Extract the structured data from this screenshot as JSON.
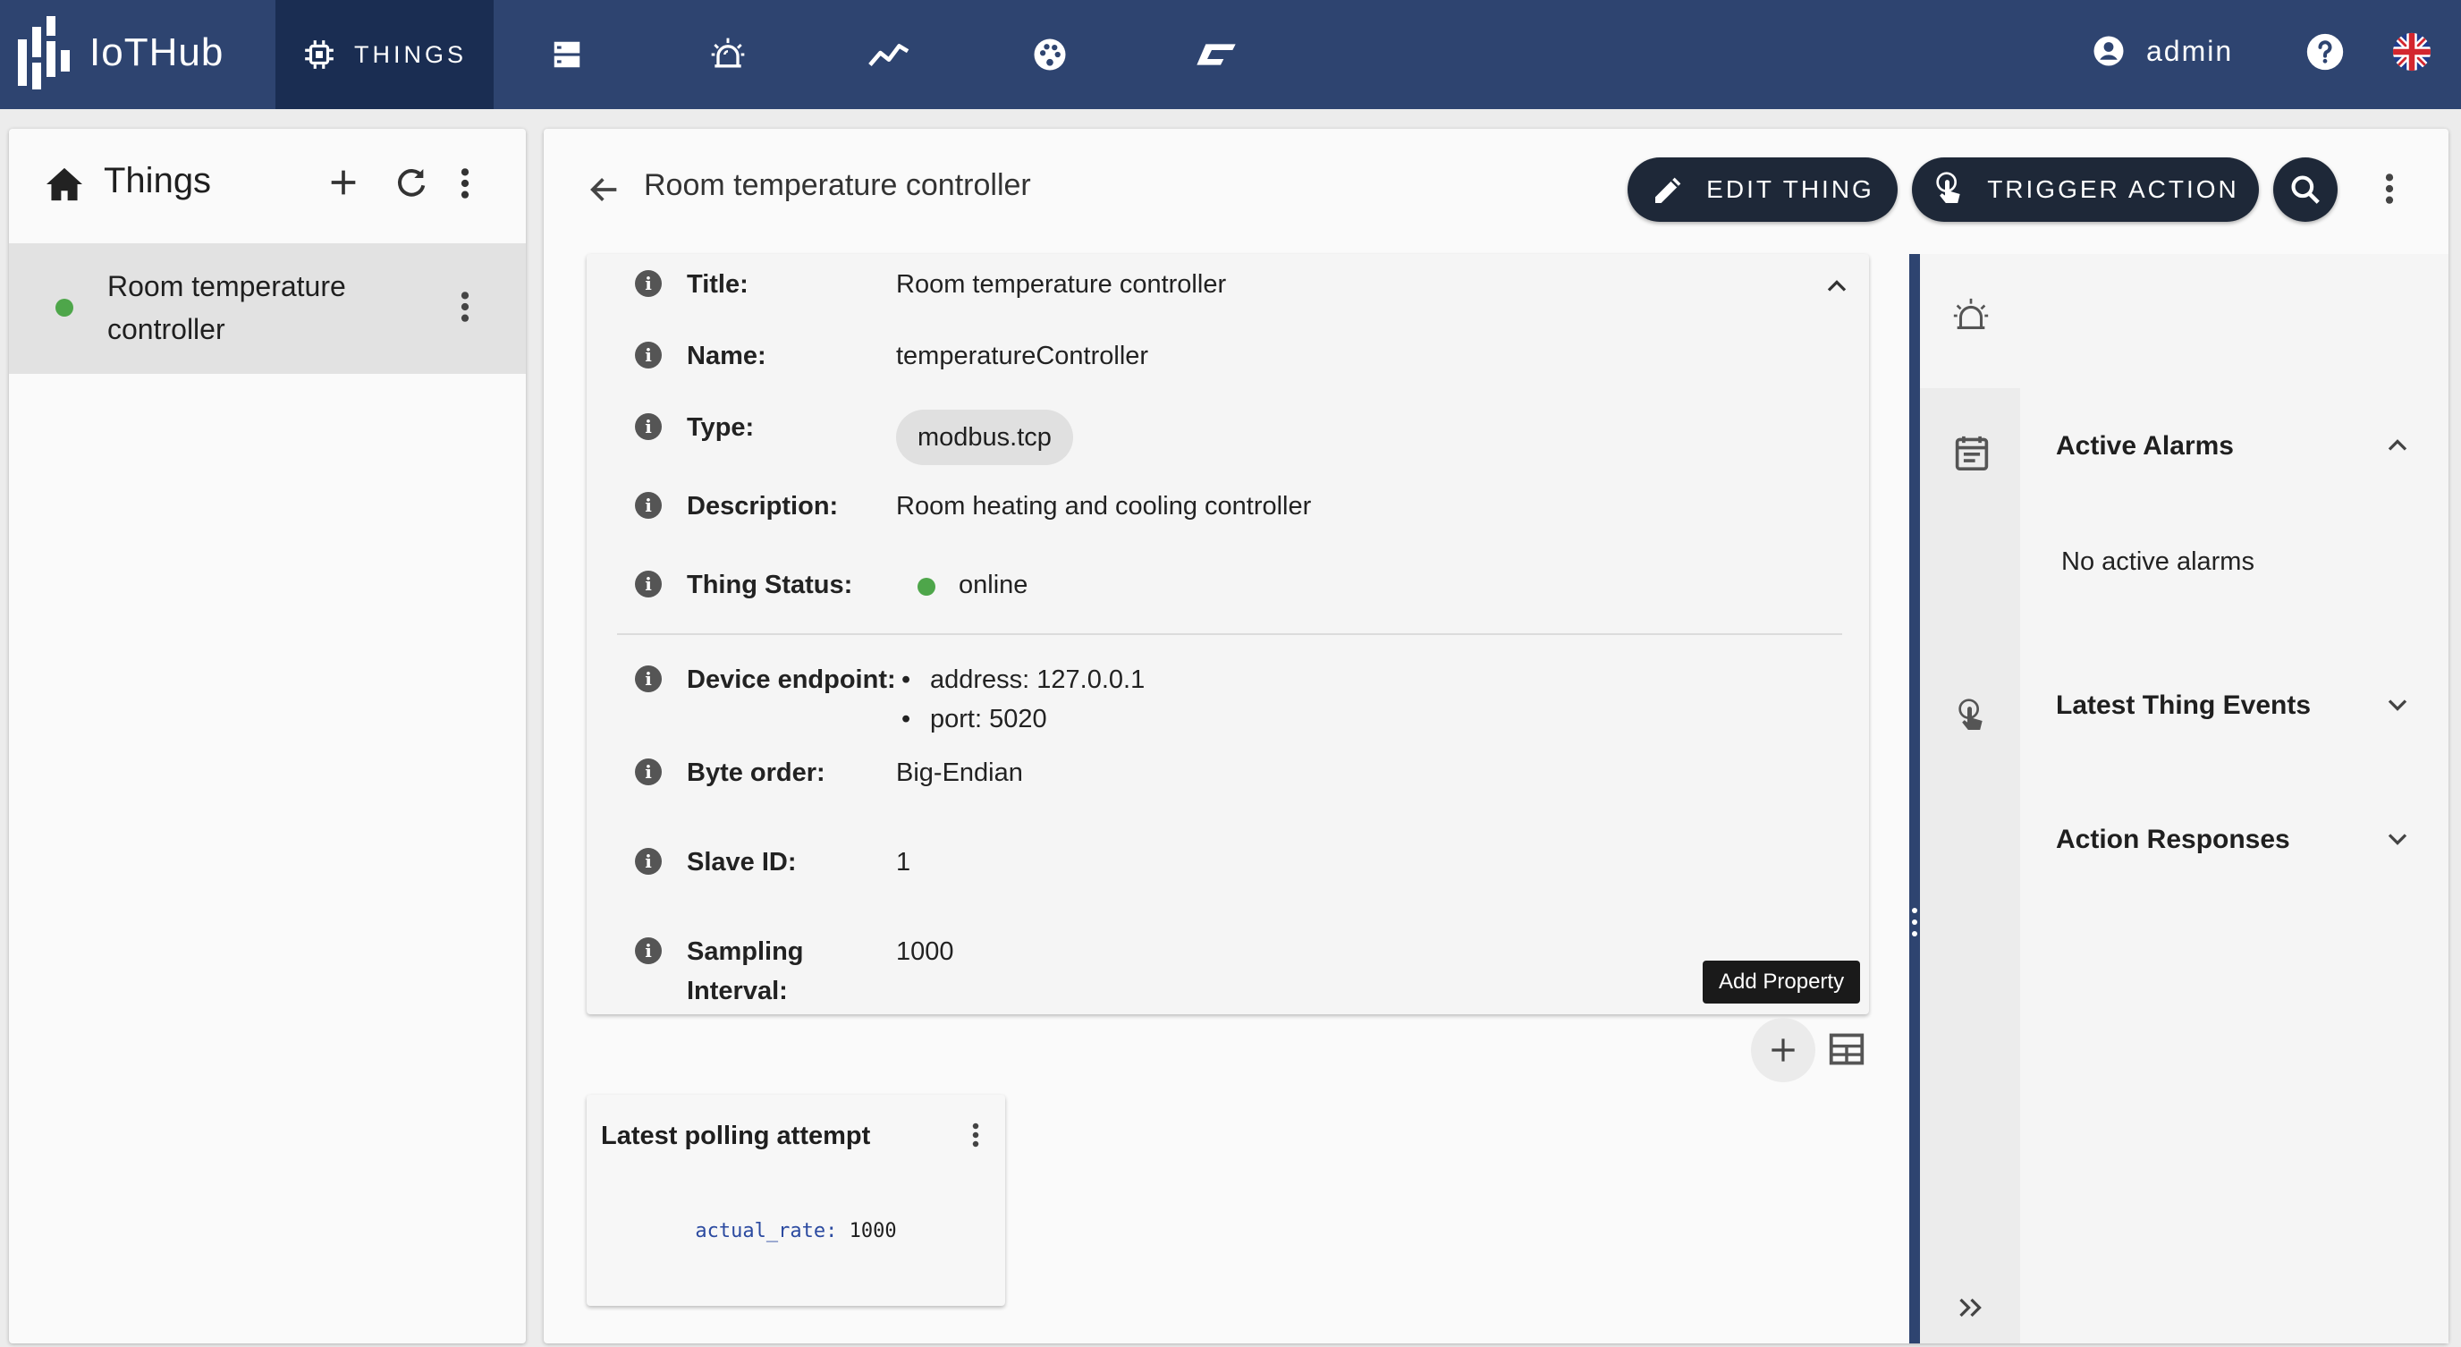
{
  "app": {
    "logo_text": "IoTHub"
  },
  "nav": {
    "items": [
      {
        "label": "THINGS",
        "icon": "chip-icon",
        "active": true
      },
      {
        "label": "",
        "icon": "server-icon"
      },
      {
        "label": "",
        "icon": "alarm-icon"
      },
      {
        "label": "",
        "icon": "trend-icon"
      },
      {
        "label": "",
        "icon": "palette-icon"
      },
      {
        "label": "",
        "icon": "rules-icon"
      }
    ],
    "user": "admin",
    "help_icon": "help-icon",
    "language_icon": "uk-flag-icon"
  },
  "sidebar": {
    "title": "Things",
    "items": [
      {
        "label": "Room temperature controller",
        "status": "online"
      }
    ]
  },
  "main": {
    "title": "Room temperature controller",
    "buttons": {
      "edit": "EDIT THING",
      "trigger": "TRIGGER ACTION"
    },
    "details": {
      "title_key": "Title:",
      "title_val": "Room temperature controller",
      "name_key": "Name:",
      "name_val": "temperatureController",
      "type_key": "Type:",
      "type_val": "modbus.tcp",
      "desc_key": "Description:",
      "desc_val": "Room heating and cooling controller",
      "status_key": "Thing Status:",
      "status_val": "online",
      "endpoint_key": "Device endpoint:",
      "endpoint_address": "address: 127.0.0.1",
      "endpoint_port": "port: 5020",
      "byte_key": "Byte order:",
      "byte_val": "Big-Endian",
      "slave_key": "Slave ID:",
      "slave_val": "1",
      "sampling_key_1": "Sampling",
      "sampling_key_2": "Interval:",
      "sampling_val": "1000"
    },
    "tooltip": "Add Property",
    "poll_card": {
      "title": "Latest polling attempt",
      "code_key": "actual_rate:",
      "code_val": " 1000"
    }
  },
  "right": {
    "active_alarms": "Active Alarms",
    "no_alarms": "No active alarms",
    "latest_events": "Latest Thing Events",
    "action_responses": "Action Responses"
  },
  "colors": {
    "nav_bg": "#2e4470",
    "nav_active": "#1a2d52",
    "button_dark": "#1e2838",
    "online": "#4ea64a"
  }
}
